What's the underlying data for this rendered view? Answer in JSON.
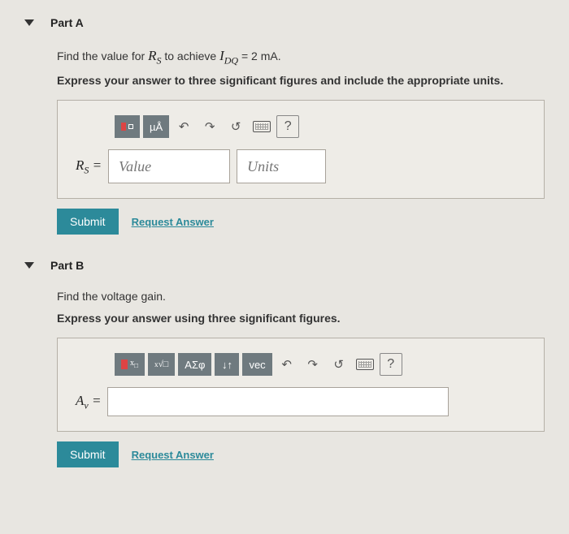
{
  "partA": {
    "title": "Part A",
    "prompt_prefix": "Find the value for ",
    "prompt_var": "R",
    "prompt_var_sub": "S",
    "prompt_mid": " to achieve ",
    "prompt_eq_left": "I",
    "prompt_eq_sub": "DQ",
    "prompt_eq_rest": " = 2 mA.",
    "instruction": "Express your answer to three significant figures and include the appropriate units.",
    "tool_units": "µÅ",
    "var_label": "R",
    "var_sub": "S",
    "equals": " = ",
    "value_placeholder": "Value",
    "units_placeholder": "Units",
    "submit": "Submit",
    "request": "Request Answer",
    "help": "?"
  },
  "partB": {
    "title": "Part B",
    "prompt": "Find the voltage gain.",
    "instruction": "Express your answer using three significant figures.",
    "tool_greek": "ΑΣφ",
    "tool_vec": "vec",
    "tool_arrows": "↓↑",
    "var_label": "A",
    "var_sub": "v",
    "equals": " = ",
    "submit": "Submit",
    "request": "Request Answer",
    "help": "?"
  }
}
